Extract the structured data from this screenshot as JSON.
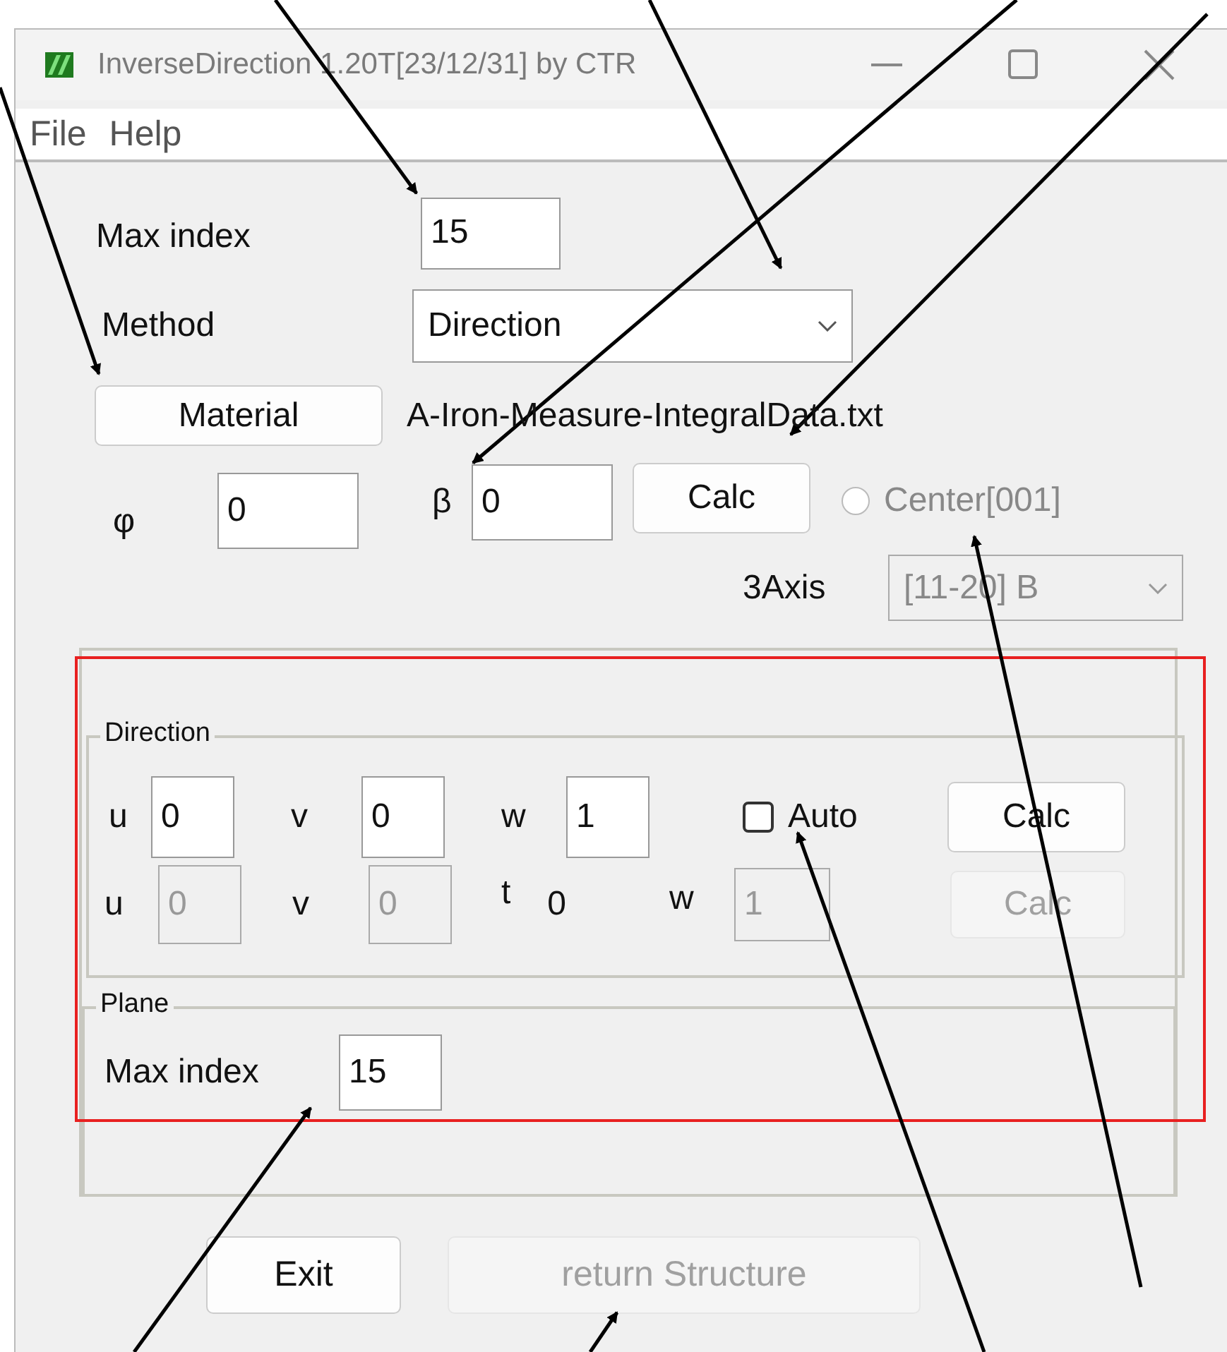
{
  "window": {
    "title": "InverseDirection 1.20T[23/12/31] by CTR"
  },
  "menu": [
    "File",
    "Help"
  ],
  "max_index": {
    "label": "Max index",
    "value": "15"
  },
  "method": {
    "label": "Method",
    "value": "Direction"
  },
  "material": {
    "button": "Material",
    "file": "A-Iron-Measure-IntegralData.txt"
  },
  "angles": {
    "phi_label": "φ",
    "phi": "0",
    "beta_label": "β",
    "beta": "0",
    "calc": "Calc"
  },
  "center": {
    "label": "Center[001]",
    "selected": false,
    "disabled": true
  },
  "axis": {
    "label": "3Axis",
    "value": "[11-20] B",
    "disabled": true
  },
  "direction": {
    "title": "Direction",
    "row1": [
      {
        "label": "u",
        "value": "0",
        "disabled": false
      },
      {
        "label": "v",
        "value": "0",
        "disabled": false
      },
      {
        "label": "w",
        "value": "1",
        "disabled": false
      }
    ],
    "auto": {
      "label": "Auto",
      "checked": false
    },
    "calc1": {
      "label": "Calc",
      "disabled": false
    },
    "row2": [
      {
        "label": "u",
        "value": "0",
        "disabled": true
      },
      {
        "label": "v",
        "value": "0",
        "disabled": true
      }
    ],
    "t": {
      "label": "t",
      "value": "0"
    },
    "row2_w": {
      "label": "w",
      "value": "1",
      "disabled": true
    },
    "calc2": {
      "label": "Calc",
      "disabled": true
    }
  },
  "plane": {
    "title": "Plane",
    "label": "Max index",
    "value": "15"
  },
  "buttons": [
    {
      "label": "Exit",
      "disabled": false
    },
    {
      "label": "return Structure",
      "disabled": true
    }
  ]
}
